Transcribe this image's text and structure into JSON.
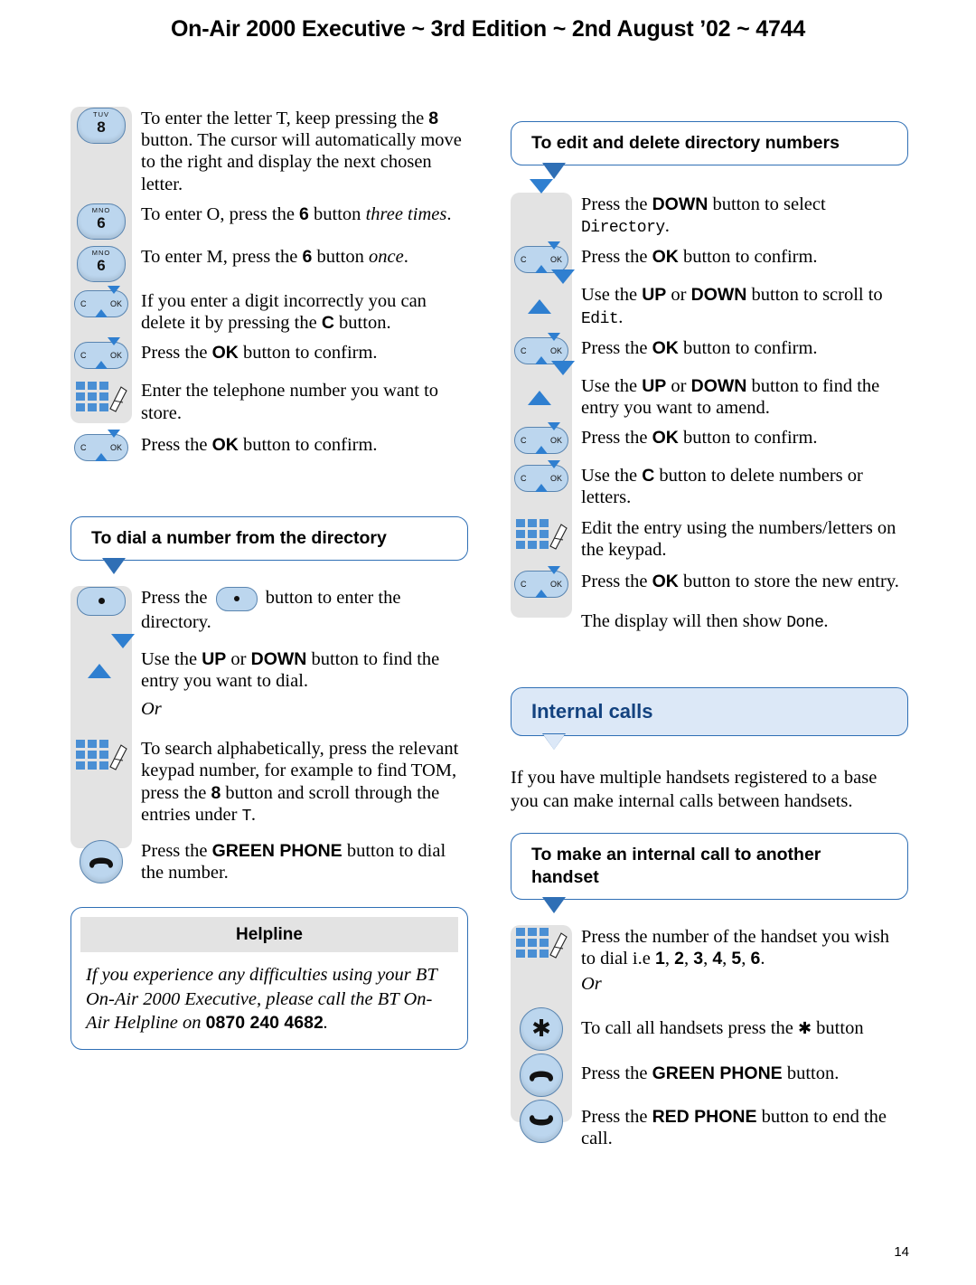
{
  "header": {
    "title": "On-Air 2000 Executive ~ 3rd Edition ~ 2nd August ’02 ~ 4744"
  },
  "page_number": "14",
  "left_column": {
    "store_steps": [
      {
        "icon": "key-8",
        "key_sub": "TUV",
        "key_num": "8",
        "text_html": "To enter the letter T, keep pressing the <b>8</b> button. The cursor will automatically move to the right and display the next chosen letter."
      },
      {
        "icon": "key-6",
        "key_sub": "MNO",
        "key_num": "6",
        "text_html": "To enter O, press the <b>6</b> button <i>three times</i>."
      },
      {
        "icon": "key-6",
        "key_sub": "MNO",
        "key_num": "6",
        "text_html": "To enter M, press the <b>6</b> button <i>once</i>."
      },
      {
        "icon": "c-ok-key",
        "text_html": "If you enter a digit incorrectly you can delete it by pressing the <b>C</b> button."
      },
      {
        "icon": "c-ok-key",
        "text_html": "Press the <b>OK</b> button to confirm."
      },
      {
        "icon": "keypad",
        "text_html": "Enter the telephone number you want to store."
      },
      {
        "icon": "c-ok-key",
        "text_html": "Press the <b>OK</b> button to confirm."
      }
    ],
    "dial_heading": "To dial a number from the directory",
    "dial_steps": [
      {
        "icon": "dot-button",
        "text_html": "Press the <span class=\"inline-dot\"><i></i></span> button to enter the directory."
      },
      {
        "icon": "up-down",
        "text_html": "Use the <b>UP</b> or <b>DOWN</b> button to find the entry you want to dial."
      },
      {
        "icon": "none",
        "text_html": "<span class=\"or\">Or</span>"
      },
      {
        "icon": "keypad",
        "text_html": "To search alphabetically, press the relevant keypad number, for example to find TOM, press the <b>8</b> button and scroll through the entries under <span class=\"mono\">T</span>."
      },
      {
        "icon": "green-phone",
        "text_html": "Press the <b>GREEN PHONE</b> button to dial the number."
      }
    ],
    "helpline": {
      "title": "Helpline",
      "body_html": "If you experience any difficulties using your BT On-Air 2000 Executive, please call the BT On-Air Helpline on <b>0870 240 4682</b>."
    }
  },
  "right_column": {
    "edit_heading": "To edit and delete directory numbers",
    "edit_steps": [
      {
        "icon": "down-arrow",
        "text_html": "Press the <b>DOWN</b> button to select <span class=\"mono\">Directory</span>."
      },
      {
        "icon": "c-ok-key",
        "text_html": "Press the <b>OK</b> button to confirm."
      },
      {
        "icon": "up-down",
        "text_html": "Use the <b>UP</b> or <b>DOWN</b> button to scroll to <span class=\"mono\">Edit</span>."
      },
      {
        "icon": "c-ok-key",
        "text_html": "Press the <b>OK</b> button to confirm."
      },
      {
        "icon": "up-down",
        "text_html": "Use the <b>UP</b> or <b>DOWN</b> button to find the entry you want to amend."
      },
      {
        "icon": "c-ok-key",
        "text_html": "Press the <b>OK</b> button to confirm."
      },
      {
        "icon": "c-ok-key",
        "text_html": "Use the <b>C</b> button to delete numbers or letters."
      },
      {
        "icon": "keypad",
        "text_html": "Edit the entry using the numbers/letters on the keypad."
      },
      {
        "icon": "c-ok-key",
        "text_html": "Press the <b>OK</b> button to store the new entry."
      },
      {
        "icon": "none",
        "text_html": "The display will then show <span class=\"mono\">Done</span>."
      }
    ],
    "internal_heading": "Internal calls",
    "internal_para": "If you have multiple handsets registered to a base you can make internal calls between handsets.",
    "internal_call_heading": "To make an internal call to another handset",
    "internal_steps": [
      {
        "icon": "keypad",
        "text_html": "Press the number of the handset you wish to dial i.e <b>1</b>, <b>2</b>, <b>3</b>, <b>4</b>, <b>5</b>, <b>6</b>."
      },
      {
        "icon": "none",
        "text_html": "<span class=\"or\">Or</span>"
      },
      {
        "icon": "star-button",
        "text_html": "To call all handsets press the <span class=\"star-inline\">✱</span> button"
      },
      {
        "icon": "green-phone",
        "text_html": "Press the <b>GREEN PHONE</b> button."
      },
      {
        "icon": "red-phone",
        "text_html": "Press the <b>RED PHONE</b> button to end the call."
      }
    ]
  }
}
